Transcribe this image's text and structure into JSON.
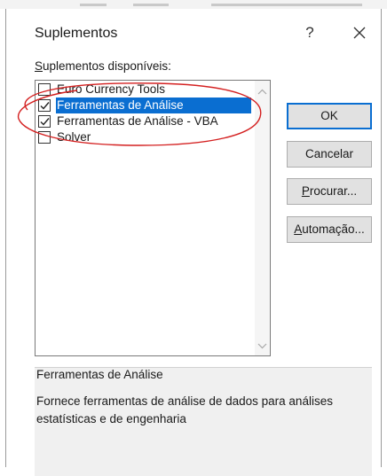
{
  "dialog": {
    "title": "Suplementos",
    "help_label": "?"
  },
  "addins": {
    "label_first": "S",
    "label_rest": "uplementos disponíveis:",
    "items": [
      {
        "label": "Euro Currency Tools",
        "checked": false,
        "selected": false
      },
      {
        "label": "Ferramentas de Análise",
        "checked": true,
        "selected": true
      },
      {
        "label": "Ferramentas de Análise - VBA",
        "checked": true,
        "selected": false
      },
      {
        "label": "Solver",
        "checked": false,
        "selected": false
      }
    ]
  },
  "buttons": {
    "ok": "OK",
    "cancel": "Cancelar",
    "browse_first": "P",
    "browse_rest": "rocurar...",
    "automation_first": "A",
    "automation_rest": "utomação..."
  },
  "description": {
    "title": "Ferramentas de Análise",
    "text": "Fornece ferramentas de análise de dados para análises estatísticas e de engenharia"
  },
  "colors": {
    "selection": "#0a6ed1",
    "annotation": "#d42020",
    "button_face": "#e1e1e1",
    "description_bg": "#f0f0f0"
  }
}
